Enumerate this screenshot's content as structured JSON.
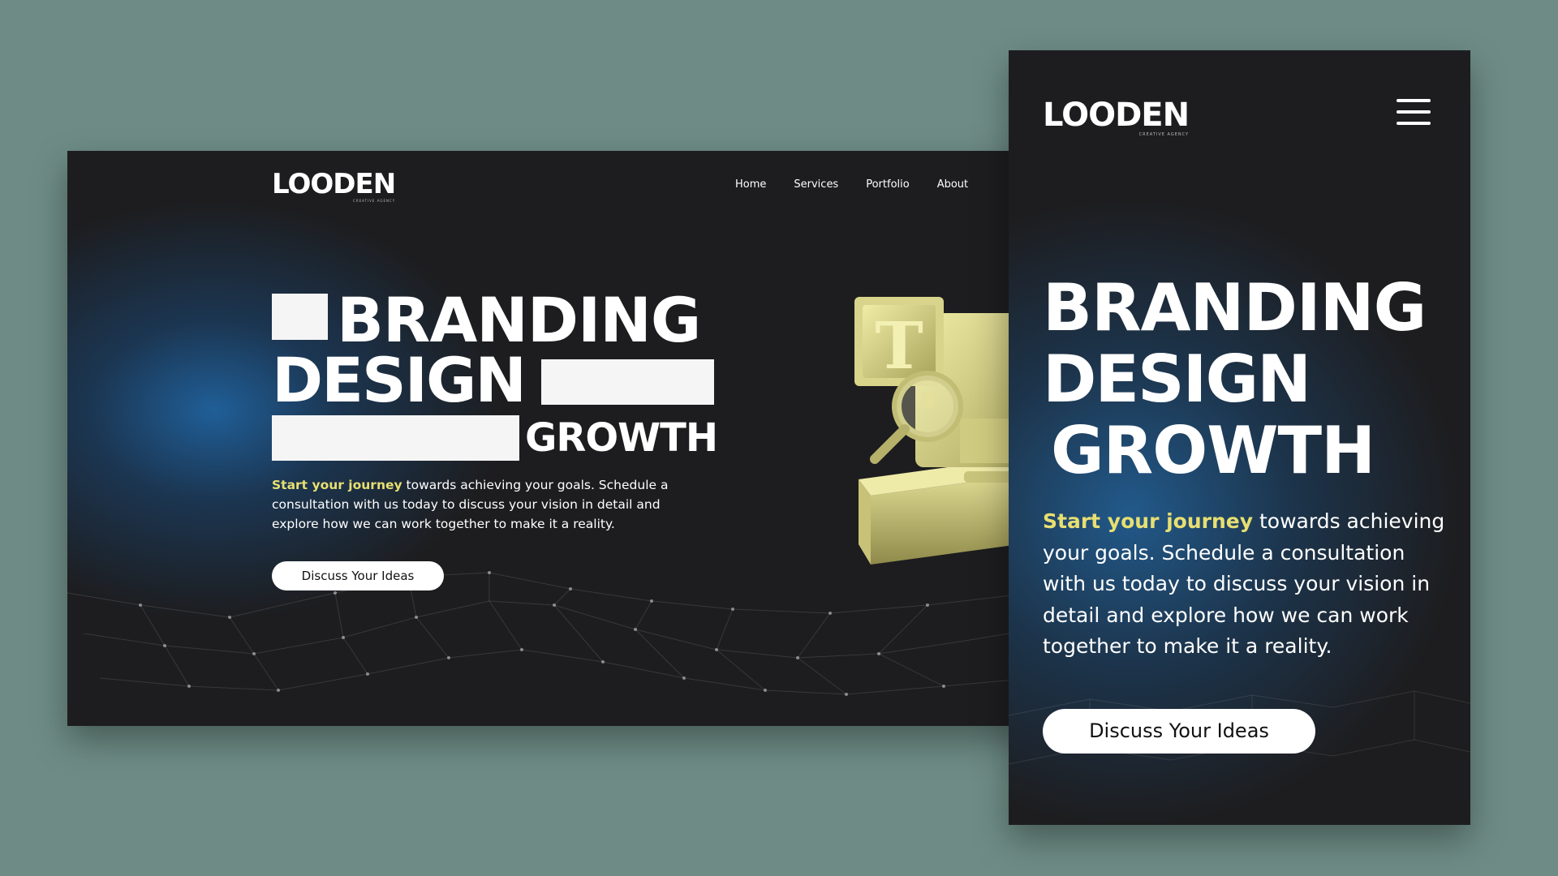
{
  "desktop": {
    "logo": {
      "text": "LOODEN",
      "tagline": "CREATIVE AGENCY"
    },
    "nav": [
      "Home",
      "Services",
      "Portfolio",
      "About"
    ],
    "headline": {
      "line1": "BRANDING",
      "line2": "DESIGN",
      "line3": "GROWTH"
    },
    "intro": {
      "highlight": "Start your journey",
      "rest": " towards achieving your goals. Schedule a consultation with us today to discuss your vision in detail and explore how we can work together to make it a reality."
    },
    "cta_label": "Discuss Your Ideas",
    "illustration_letter": "T"
  },
  "mobile": {
    "logo": {
      "text": "LOODEN",
      "tagline": "CREATIVE AGENCY"
    },
    "headline": {
      "line1": "BRANDING",
      "line2": "DESIGN",
      "line3": "GROWTH"
    },
    "intro": {
      "highlight": "Start your journey",
      "rest": " towards achieving your goals. Schedule a consultation with us today to discuss your vision in detail and explore how we can work together to make it a reality."
    },
    "cta_label": "Discuss Your Ideas",
    "menu_icon": "hamburger-menu-icon"
  },
  "colors": {
    "background": "#6e8c85",
    "page_dark": "#1d1d1f",
    "accent_yellow": "#e8df71",
    "glow_blue": "#20629e",
    "illustration": "#dcd98a"
  }
}
